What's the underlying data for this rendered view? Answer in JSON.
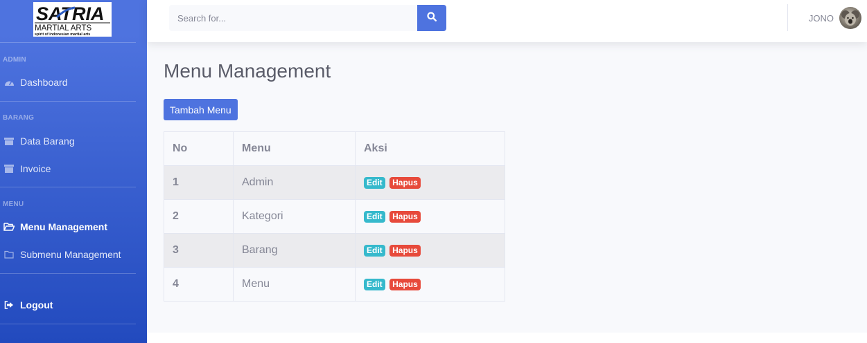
{
  "brand": {
    "logo_text": "SATRIA",
    "logo_sub": "MARTIAL ARTS",
    "logo_tagline": "spirit of indonesian martial arts"
  },
  "sidebar": {
    "sections": [
      {
        "heading": "ADMIN",
        "items": [
          {
            "label": "Dashboard",
            "icon": "tachometer-icon"
          }
        ]
      },
      {
        "heading": "BARANG",
        "items": [
          {
            "label": "Data Barang",
            "icon": "box-icon"
          },
          {
            "label": "Invoice",
            "icon": "archive-icon"
          }
        ]
      },
      {
        "heading": "MENU",
        "items": [
          {
            "label": "Menu Management",
            "icon": "folder-open-icon",
            "active": true
          },
          {
            "label": "Submenu Management",
            "icon": "folder-icon"
          }
        ]
      }
    ],
    "logout_label": "Logout"
  },
  "topbar": {
    "search_placeholder": "Search for...",
    "user_name": "JONO"
  },
  "main": {
    "title": "Menu Management",
    "add_button": "Tambah Menu",
    "table": {
      "headers": [
        "No",
        "Menu",
        "Aksi"
      ],
      "rows": [
        {
          "no": "1",
          "menu": "Admin"
        },
        {
          "no": "2",
          "menu": "Kategori"
        },
        {
          "no": "3",
          "menu": "Barang"
        },
        {
          "no": "4",
          "menu": "Menu"
        }
      ],
      "edit_label": "Edit",
      "delete_label": "Hapus"
    }
  },
  "colors": {
    "primary": "#4e73df",
    "info": "#36b9cc",
    "danger": "#e74a3b"
  }
}
